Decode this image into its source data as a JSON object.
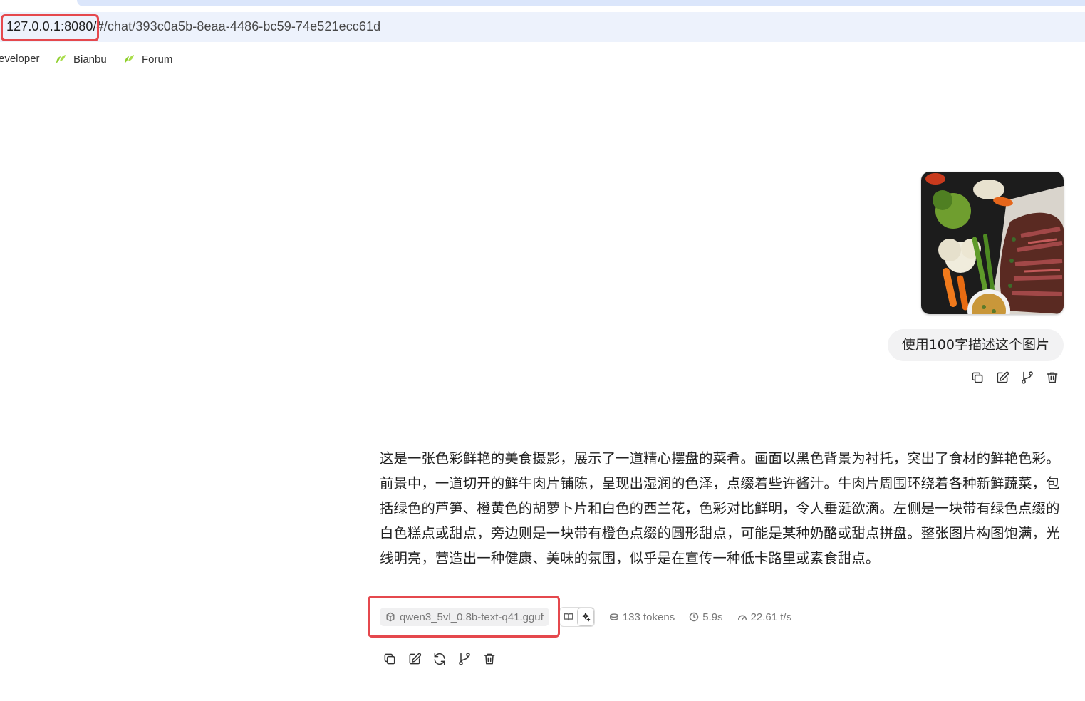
{
  "browser": {
    "url_host": "127.0.0.1:8080/",
    "url_path": "#/chat/393c0a5b-8eaa-4486-bc59-74e521ecc61d",
    "bookmarks": [
      {
        "label": "eveloper"
      },
      {
        "label": "Bianbu"
      },
      {
        "label": "Forum"
      }
    ],
    "bookmark_icon_color": "#8fcf2e"
  },
  "user_message": {
    "image_alt": "food photo",
    "text": "使用100字描述这个图片",
    "actions": [
      "copy-icon",
      "edit-icon",
      "branch-icon",
      "delete-icon"
    ]
  },
  "assistant_message": {
    "text": "这是一张色彩鲜艳的美食摄影，展示了一道精心摆盘的菜肴。画面以黑色背景为衬托，突出了食材的鲜艳色彩。前景中，一道切开的鲜牛肉片铺陈，呈现出湿润的色泽，点缀着些许酱汁。牛肉片周围环绕着各种新鲜蔬菜，包括绿色的芦笋、橙黄色的胡萝卜片和白色的西兰花，色彩对比鲜明，令人垂涎欲滴。左侧是一块带有绿色点缀的白色糕点或甜点，旁边则是一块带有橙色点缀的圆形甜点，可能是某种奶酪或甜点拼盘。整张图片构图饱满，光线明亮，营造出一种健康、美味的氛围，似乎是在宣传一种低卡路里或素食甜点。",
    "model": "qwen3_5vl_0.8b-text-q41.gguf",
    "tokens": "133 tokens",
    "time": "5.9s",
    "speed": "22.61 t/s",
    "actions": [
      "copy-icon",
      "edit-icon",
      "regenerate-icon",
      "branch-icon",
      "delete-icon"
    ]
  },
  "colors": {
    "highlight": "#e5484d",
    "bubble": "#f2f2f3",
    "urlbar": "#edf2fc"
  }
}
